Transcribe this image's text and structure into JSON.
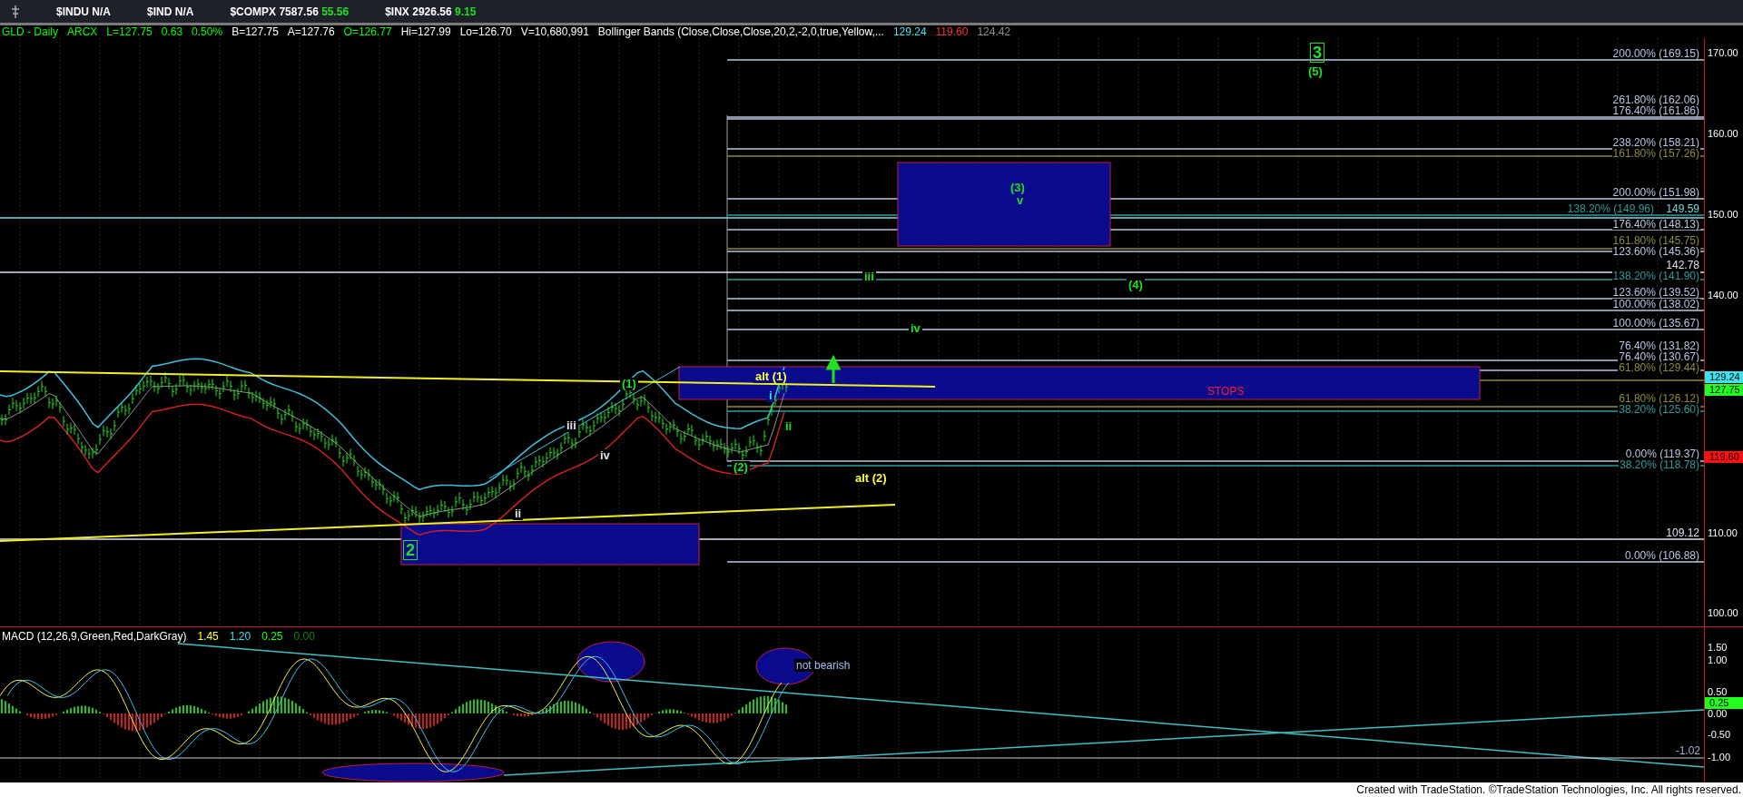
{
  "ticker_bar": {
    "items": [
      {
        "symbol": "$INDU",
        "value": "N/A"
      },
      {
        "symbol": "$IND",
        "value": "N/A"
      },
      {
        "symbol": "$COMPX",
        "value": "7587.56",
        "change": "55.56"
      },
      {
        "symbol": "$INX",
        "value": "2926.56",
        "change": "9.15"
      }
    ]
  },
  "header": {
    "fields": [
      {
        "text": "GLD - Daily",
        "color": "#00ff00"
      },
      {
        "text": "ARCX",
        "color": "#00ff00"
      },
      {
        "text": "L=127.75",
        "color": "#00ff00"
      },
      {
        "text": "0.63",
        "color": "#00ff00"
      },
      {
        "text": "0.50%",
        "color": "#00ff00"
      },
      {
        "text": "B=127.75",
        "color": "#ffffff"
      },
      {
        "text": "A=127.76",
        "color": "#ffffff"
      },
      {
        "text": "O=126.77",
        "color": "#00ff00"
      },
      {
        "text": "Hi=127.99",
        "color": "#ffffff"
      },
      {
        "text": "Lo=126.70",
        "color": "#ffffff"
      },
      {
        "text": "V=10,680,991",
        "color": "#ffffff"
      },
      {
        "text": "Bollinger Bands (Close,Close,Close,20,2,-2,0,true,Yellow,...",
        "color": "#ffffff"
      },
      {
        "text": "129.24",
        "color": "#40e0f0"
      },
      {
        "text": "119.60",
        "color": "#ff3030"
      },
      {
        "text": "124.42",
        "color": "#909090"
      }
    ]
  },
  "price_pane": {
    "axis_ticks": [
      "170.00",
      "160.00",
      "150.00",
      "140.00",
      "110.00",
      "100.00"
    ],
    "price_markers": [
      {
        "text": "129.24",
        "color": "#40e0f0"
      },
      {
        "text": "127.75",
        "color": "#20ff20"
      },
      {
        "text": "119.60",
        "color": "#ff1010"
      }
    ],
    "levels": [
      {
        "kind": "fib",
        "label": "200.00% (169.15)",
        "color": "#b8c4e0"
      },
      {
        "kind": "fib",
        "label": "261.80% (162.06)",
        "color": "#b8c4e0"
      },
      {
        "kind": "fib",
        "label": "176.40% (161.86)",
        "color": "#b8c4e0"
      },
      {
        "kind": "fib",
        "label": "238.20% (158.21)",
        "color": "#b8c4e0"
      },
      {
        "kind": "fib",
        "label": "161.80% (157.26)",
        "color": "#8c8c3c"
      },
      {
        "kind": "fib",
        "label": "200.00% (151.98)",
        "color": "#b8c4e0"
      },
      {
        "kind": "fib",
        "label": "138.20% (149.96)",
        "color": "#2e9c9c"
      },
      {
        "kind": "line",
        "label": "149.59",
        "color": "#7fd8e0"
      },
      {
        "kind": "fib",
        "label": "176.40% (148.13)",
        "color": "#b8c4e0"
      },
      {
        "kind": "fib",
        "label": "161.80% (145.75)",
        "color": "#8c8c3c"
      },
      {
        "kind": "fib",
        "label": "123.60% (145.36)",
        "color": "#b8c4e0"
      },
      {
        "kind": "line",
        "label": "142.78",
        "color": "#e0e0f0"
      },
      {
        "kind": "fib",
        "label": "138.20% (141.90)",
        "color": "#2e9c9c"
      },
      {
        "kind": "fib",
        "label": "123.60% (139.52)",
        "color": "#b8c4e0"
      },
      {
        "kind": "fib",
        "label": "100.00% (138.02)",
        "color": "#b8c4e0"
      },
      {
        "kind": "fib",
        "label": "100.00% (135.67)",
        "color": "#b8c4e0"
      },
      {
        "kind": "fib",
        "label": "76.40% (131.82)",
        "color": "#b8c4e0"
      },
      {
        "kind": "fib",
        "label": "76.40% (130.67)",
        "color": "#b8c4e0"
      },
      {
        "kind": "fib",
        "label": "61.80% (129.44)",
        "color": "#8c8c3c"
      },
      {
        "kind": "fib",
        "label": "61.80% (126.12)",
        "color": "#8c8c3c"
      },
      {
        "kind": "fib",
        "label": "38.20% (125.60)",
        "color": "#2e9c9c"
      },
      {
        "kind": "fib",
        "label": "0.00% (119.37)",
        "color": "#b8c4e0"
      },
      {
        "kind": "fib",
        "label": "38.20% (118.78)",
        "color": "#2e9c9c"
      },
      {
        "kind": "line",
        "label": "109.12",
        "color": "#e0e0f0"
      },
      {
        "kind": "fib",
        "label": "0.00% (106.88)",
        "color": "#b8c4e0"
      }
    ],
    "wave_labels": [
      {
        "kind": "major",
        "text": "3",
        "color": "#20e020"
      },
      {
        "kind": "minor",
        "text": "(5)",
        "color": "#20e020"
      },
      {
        "kind": "minor",
        "text": "(3)",
        "color": "#20e020"
      },
      {
        "kind": "minor",
        "text": "v",
        "color": "#20e020"
      },
      {
        "kind": "minor",
        "text": "iii",
        "color": "#20e020"
      },
      {
        "kind": "minor",
        "text": "(4)",
        "color": "#20e020"
      },
      {
        "kind": "minor",
        "text": "iv",
        "color": "#20e020"
      },
      {
        "kind": "minor",
        "text": "alt (1)",
        "color": "#ffff40"
      },
      {
        "kind": "minor",
        "text": "i",
        "color": "#40e0f0"
      },
      {
        "kind": "minor",
        "text": "ii",
        "color": "#20e020"
      },
      {
        "kind": "minor",
        "text": "(1)",
        "color": "#20e020"
      },
      {
        "kind": "minor",
        "text": "iii",
        "color": "#e0e0e0"
      },
      {
        "kind": "minor",
        "text": "iv",
        "color": "#e0e0e0"
      },
      {
        "kind": "minor",
        "text": "(2)",
        "color": "#20e020"
      },
      {
        "kind": "minor",
        "text": "alt (2)",
        "color": "#ffff40"
      },
      {
        "kind": "minor",
        "text": "ii",
        "color": "#e0e0e0"
      },
      {
        "kind": "major",
        "text": "2",
        "color": "#20e020"
      }
    ],
    "zone_label": {
      "text": "STOPS",
      "color": "#ff2020"
    }
  },
  "macd_pane": {
    "title": "MACD (12,26,9,Green,Red,DarkGray)",
    "readings": [
      {
        "text": "1.45",
        "color": "#ffff40"
      },
      {
        "text": "1.20",
        "color": "#40e0f0"
      },
      {
        "text": "0.25",
        "color": "#20ff20"
      },
      {
        "text": "0.00",
        "color": "#108010"
      }
    ],
    "axis_ticks": [
      "1.50",
      "1.00",
      "0.50",
      "0.00",
      "-0.50",
      "-1.00"
    ],
    "marker": {
      "text": "0.25",
      "color": "#20ff20"
    },
    "line_label": "-1.02",
    "note": "not bearish"
  },
  "footer": "Created with TradeStation. ©TradeStation Technologies, Inc. All rights reserved."
}
